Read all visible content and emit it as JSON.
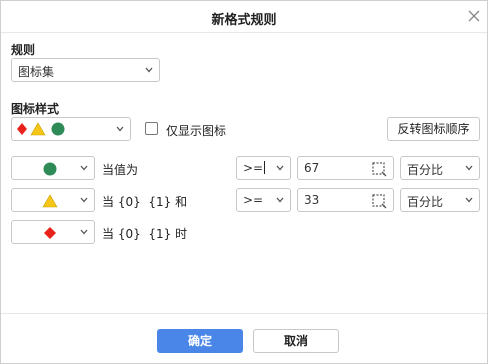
{
  "dialog": {
    "title": "新格式规则"
  },
  "rule": {
    "label": "规则",
    "selected": "图标集"
  },
  "icon_style": {
    "label": "图标样式",
    "show_icon_only_label": "仅显示图标",
    "show_icon_only_checked": false,
    "reverse_button": "反转图标顺序"
  },
  "conditions": [
    {
      "icon": "green-circle",
      "text": "当值为",
      "operator": ">=",
      "value": "67",
      "type": "百分比"
    },
    {
      "icon": "yellow-triangle",
      "text": "当 {0}  {1} 和",
      "operator": ">=",
      "value": "33",
      "type": "百分比"
    },
    {
      "icon": "red-diamond",
      "text": "当 {0}  {1} 时"
    }
  ],
  "footer": {
    "ok": "确定",
    "cancel": "取消"
  },
  "colors": {
    "primary": "#4a86e8",
    "green": "#2e8b57",
    "yellow": "#f5c518",
    "red": "#e8221b"
  }
}
